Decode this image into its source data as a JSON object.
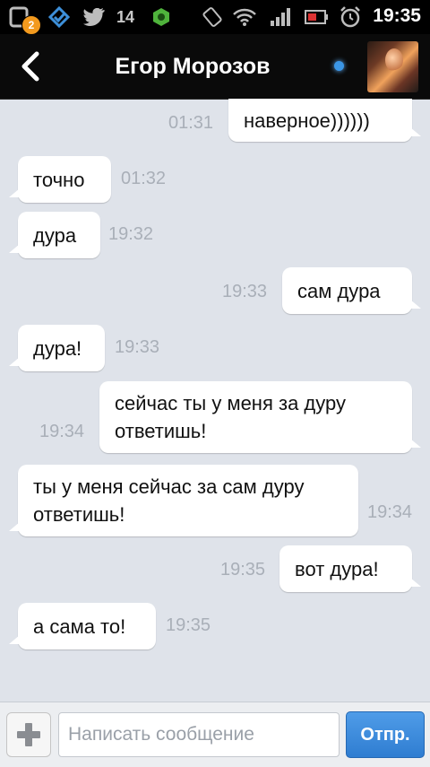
{
  "status_bar": {
    "notification_count_badge": "2",
    "twitter_count": "14",
    "time": "19:35"
  },
  "header": {
    "back_icon": "chevron-left-icon",
    "contact_name": "Егор Морозов",
    "online_indicator_color": "#3b96e6"
  },
  "messages": [
    {
      "direction": "out",
      "text": "наверное))))))",
      "time": "01:31"
    },
    {
      "direction": "in",
      "text": "точно",
      "time": "01:32"
    },
    {
      "direction": "in",
      "text": "дура",
      "time": "19:32"
    },
    {
      "direction": "out",
      "text": "сам дура",
      "time": "19:33"
    },
    {
      "direction": "in",
      "text": "дура!",
      "time": "19:33"
    },
    {
      "direction": "out",
      "text": "сейчас ты у меня за дуру ответишь!",
      "time": "19:34"
    },
    {
      "direction": "in",
      "text": "ты у меня сейчас за сам дуру ответишь!",
      "time": "19:34"
    },
    {
      "direction": "out",
      "text": "вот дура!",
      "time": "19:35"
    },
    {
      "direction": "in",
      "text": "а сама то!",
      "time": "19:35"
    }
  ],
  "composer": {
    "attach_icon": "plus-icon",
    "placeholder": "Написать сообщение",
    "send_label": "Отпр.",
    "accent_color": "#2f7dd1"
  }
}
